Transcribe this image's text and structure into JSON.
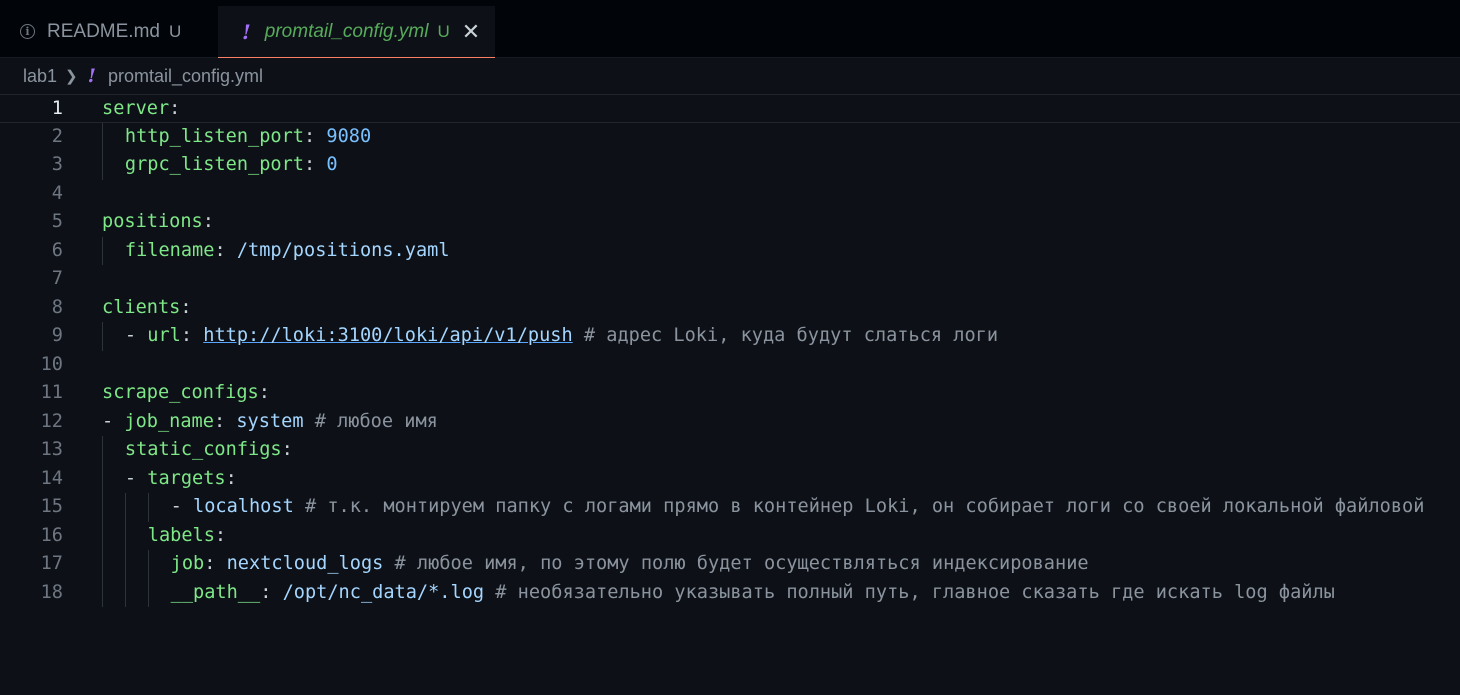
{
  "tabs": [
    {
      "title": "README.md",
      "badge": "U",
      "icon": "info-icon",
      "active": false
    },
    {
      "title": "promtail_config.yml",
      "badge": "U",
      "icon": "yaml-exclamation-icon",
      "active": true
    }
  ],
  "breadcrumb": {
    "folder": "lab1",
    "file": "promtail_config.yml"
  },
  "colors": {
    "key": "#7ee787",
    "number": "#79c0ff",
    "string": "#a5d6ff",
    "comment": "#8b949e",
    "accent_tab": "#f78166",
    "yml_icon": "#a371f7"
  },
  "lines": [
    {
      "n": "1",
      "indent": 0,
      "parts": [
        {
          "t": "server",
          "c": "k"
        },
        {
          "t": ":",
          "c": "p"
        }
      ]
    },
    {
      "n": "2",
      "indent": 1,
      "parts": [
        {
          "t": "http_listen_port",
          "c": "k"
        },
        {
          "t": ": ",
          "c": "p"
        },
        {
          "t": "9080",
          "c": "n"
        }
      ]
    },
    {
      "n": "3",
      "indent": 1,
      "parts": [
        {
          "t": "grpc_listen_port",
          "c": "k"
        },
        {
          "t": ": ",
          "c": "p"
        },
        {
          "t": "0",
          "c": "n"
        }
      ]
    },
    {
      "n": "4",
      "indent": 0,
      "parts": []
    },
    {
      "n": "5",
      "indent": 0,
      "parts": [
        {
          "t": "positions",
          "c": "k"
        },
        {
          "t": ":",
          "c": "p"
        }
      ]
    },
    {
      "n": "6",
      "indent": 1,
      "parts": [
        {
          "t": "filename",
          "c": "k"
        },
        {
          "t": ": ",
          "c": "p"
        },
        {
          "t": "/tmp/positions.yaml",
          "c": "s"
        }
      ]
    },
    {
      "n": "7",
      "indent": 0,
      "parts": []
    },
    {
      "n": "8",
      "indent": 0,
      "parts": [
        {
          "t": "clients",
          "c": "k"
        },
        {
          "t": ":",
          "c": "p"
        }
      ]
    },
    {
      "n": "9",
      "indent": 1,
      "parts": [
        {
          "t": "- ",
          "c": "p"
        },
        {
          "t": "url",
          "c": "k"
        },
        {
          "t": ": ",
          "c": "p"
        },
        {
          "t": "http://loki:3100/loki/api/v1/push",
          "c": "link"
        },
        {
          "t": " # адрес Loki, куда будут слаться логи",
          "c": "c"
        }
      ]
    },
    {
      "n": "10",
      "indent": 0,
      "parts": []
    },
    {
      "n": "11",
      "indent": 0,
      "parts": [
        {
          "t": "scrape_configs",
          "c": "k"
        },
        {
          "t": ":",
          "c": "p"
        }
      ]
    },
    {
      "n": "12",
      "indent": 0,
      "parts": [
        {
          "t": "- ",
          "c": "p"
        },
        {
          "t": "job_name",
          "c": "k"
        },
        {
          "t": ": ",
          "c": "p"
        },
        {
          "t": "system",
          "c": "s"
        },
        {
          "t": " # любое имя",
          "c": "c"
        }
      ]
    },
    {
      "n": "13",
      "indent": 1,
      "parts": [
        {
          "t": "static_configs",
          "c": "k"
        },
        {
          "t": ":",
          "c": "p"
        }
      ]
    },
    {
      "n": "14",
      "indent": 1,
      "parts": [
        {
          "t": "- ",
          "c": "p"
        },
        {
          "t": "targets",
          "c": "k"
        },
        {
          "t": ":",
          "c": "p"
        }
      ]
    },
    {
      "n": "15",
      "indent": 3,
      "parts": [
        {
          "t": "- ",
          "c": "p"
        },
        {
          "t": "localhost",
          "c": "s"
        },
        {
          "t": " # т.к. монтируем папку с логами прямо в контейнер Loki, он собирает логи со своей локальной файловой",
          "c": "c"
        }
      ]
    },
    {
      "n": "16",
      "indent": 2,
      "parts": [
        {
          "t": "labels",
          "c": "k"
        },
        {
          "t": ":",
          "c": "p"
        }
      ]
    },
    {
      "n": "17",
      "indent": 3,
      "parts": [
        {
          "t": "job",
          "c": "k"
        },
        {
          "t": ": ",
          "c": "p"
        },
        {
          "t": "nextcloud_logs",
          "c": "s"
        },
        {
          "t": " # любое имя, по этому полю будет осуществляться индексирование",
          "c": "c"
        }
      ]
    },
    {
      "n": "18",
      "indent": 3,
      "parts": [
        {
          "t": "__path__",
          "c": "k"
        },
        {
          "t": ": ",
          "c": "p"
        },
        {
          "t": "/opt/nc_data/*.log",
          "c": "s"
        },
        {
          "t": " # необязательно указывать полный путь, главное сказать где искать log файлы",
          "c": "c"
        }
      ]
    }
  ]
}
